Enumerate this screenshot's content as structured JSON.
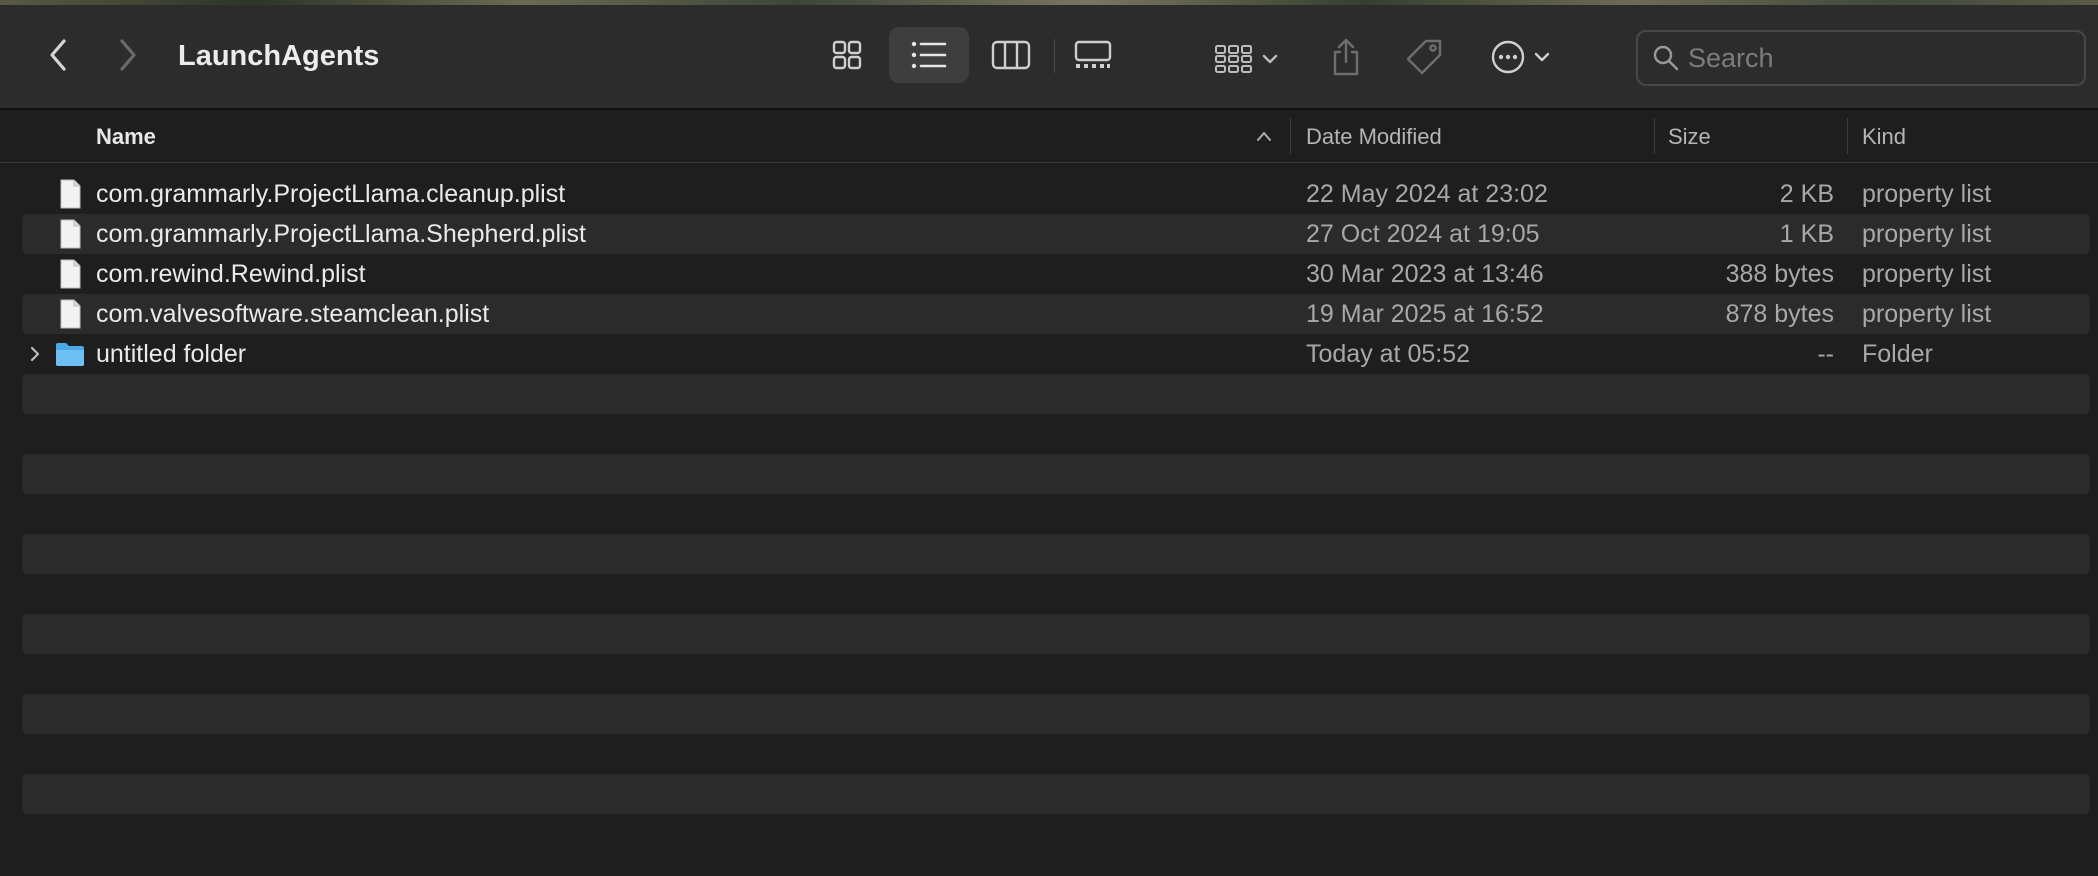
{
  "window": {
    "title": "LaunchAgents"
  },
  "toolbar": {
    "back": "chevron-left-icon",
    "forward": "chevron-right-icon",
    "views": [
      "icon-view-icon",
      "list-view-icon",
      "column-view-icon",
      "gallery-view-icon"
    ],
    "active_view": "list-view-icon",
    "group": "group-by-icon",
    "share": "share-icon",
    "tags": "tag-icon",
    "actions": "more-actions-icon"
  },
  "search": {
    "placeholder": "Search",
    "value": ""
  },
  "columns": {
    "name": "Name",
    "date_modified": "Date Modified",
    "size": "Size",
    "kind": "Kind",
    "sorted_by": "name",
    "sort_direction": "ascending"
  },
  "files": [
    {
      "name": "com.grammarly.ProjectLlama.cleanup.plist",
      "date_modified": "22 May 2024 at 23:02",
      "size": "2 KB",
      "kind": "property list",
      "type": "document"
    },
    {
      "name": "com.grammarly.ProjectLlama.Shepherd.plist",
      "date_modified": "27 Oct 2024 at 19:05",
      "size": "1 KB",
      "kind": "property list",
      "type": "document"
    },
    {
      "name": "com.rewind.Rewind.plist",
      "date_modified": "30 Mar 2023 at 13:46",
      "size": "388 bytes",
      "kind": "property list",
      "type": "document"
    },
    {
      "name": "com.valvesoftware.steamclean.plist",
      "date_modified": "19 Mar 2025 at 16:52",
      "size": "878 bytes",
      "kind": "property list",
      "type": "document"
    },
    {
      "name": "untitled folder",
      "date_modified": "Today at 05:52",
      "size": "--",
      "kind": "Folder",
      "type": "folder"
    }
  ],
  "empty_row_count": 12,
  "colors": {
    "window_bg": "#1e1e1e",
    "toolbar_bg": "#2c2c2c",
    "alt_row_bg": "#2b2b2b",
    "folder_blue": "#4aa8e6"
  }
}
